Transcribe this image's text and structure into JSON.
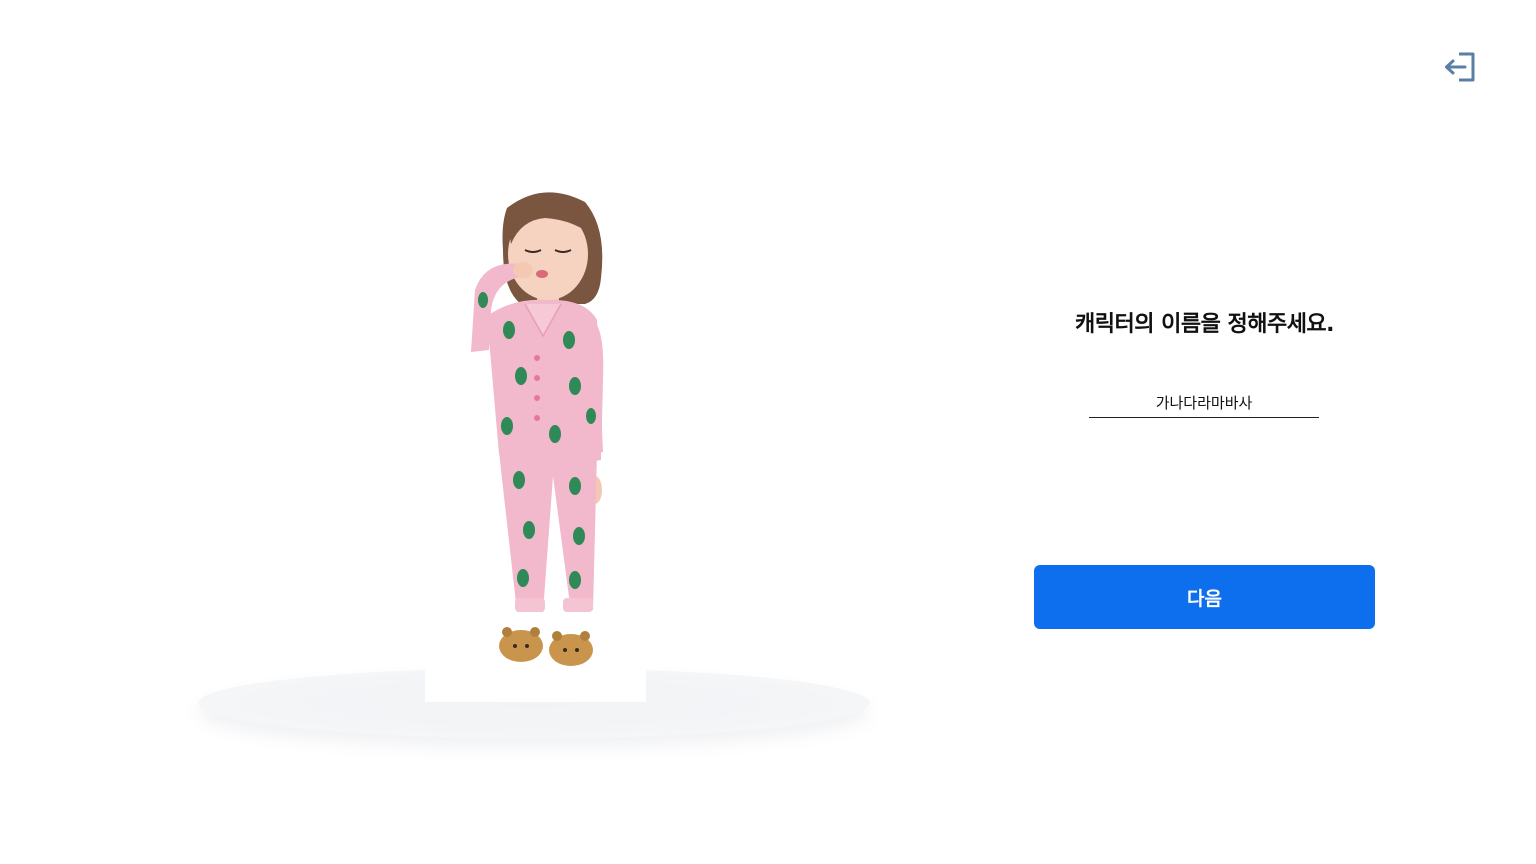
{
  "header": {
    "exit_icon": "exit-icon"
  },
  "panel": {
    "title": "캐릭터의 이름을 정해주세요.",
    "name_input_value": "가나다라마바사",
    "next_label": "다음"
  },
  "colors": {
    "primary": "#0d6fed",
    "exit_icon": "#5b7ea6",
    "pajama": "#f2b8cb",
    "pattern": "#2f8a57"
  }
}
